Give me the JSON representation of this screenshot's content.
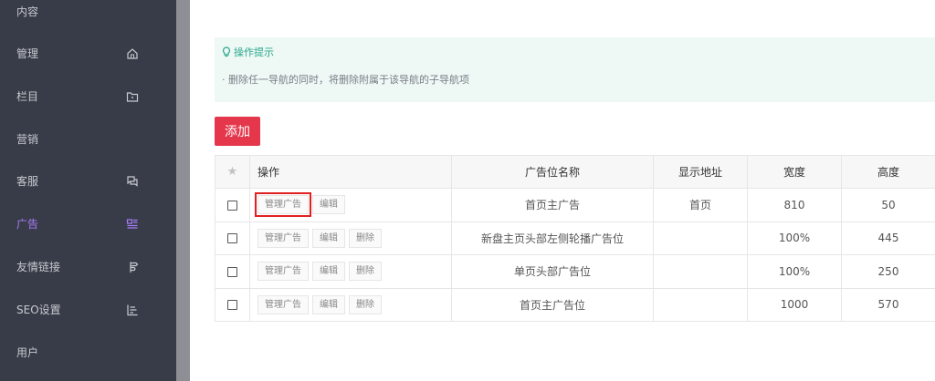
{
  "sidebar": {
    "items": [
      {
        "label": "内容",
        "icon": "",
        "active": false
      },
      {
        "label": "管理",
        "icon": "home-icon",
        "active": false
      },
      {
        "label": "栏目",
        "icon": "folder-icon",
        "active": false
      },
      {
        "label": "营销",
        "icon": "",
        "active": false
      },
      {
        "label": "客服",
        "icon": "chat-icon",
        "active": false
      },
      {
        "label": "广告",
        "icon": "ad-icon",
        "active": true
      },
      {
        "label": "友情链接",
        "icon": "signpost-icon",
        "active": false
      },
      {
        "label": "SEO设置",
        "icon": "list-chart-icon",
        "active": false
      },
      {
        "label": "用户",
        "icon": "",
        "active": false
      }
    ],
    "active_color": "#a77cf5"
  },
  "tips": {
    "title": "操作提示",
    "text": "· 删除任一导航的同时，将删除附属于该导航的子导航项"
  },
  "toolbar": {
    "add_label": "添加"
  },
  "table": {
    "headers": {
      "star": "★",
      "op": "操作",
      "name": "广告位名称",
      "address": "显示地址",
      "width": "宽度",
      "height": "高度"
    },
    "rows": [
      {
        "manage": "管理广告",
        "edit": "编辑",
        "delete": "",
        "name": "首页主广告",
        "address": "首页",
        "width": "810",
        "height": "50"
      },
      {
        "manage": "管理广告",
        "edit": "编辑",
        "delete": "删除",
        "name": "新盘主页头部左侧轮播广告位",
        "address": "",
        "width": "100%",
        "height": "445"
      },
      {
        "manage": "管理广告",
        "edit": "编辑",
        "delete": "删除",
        "name": "单页头部广告位",
        "address": "",
        "width": "100%",
        "height": "250"
      },
      {
        "manage": "管理广告",
        "edit": "编辑",
        "delete": "删除",
        "name": "首页主广告位",
        "address": "",
        "width": "1000",
        "height": "570"
      }
    ]
  },
  "colors": {
    "add_button": "#e5374b",
    "tips_title": "#2aa68b",
    "highlight": "#e02020"
  }
}
